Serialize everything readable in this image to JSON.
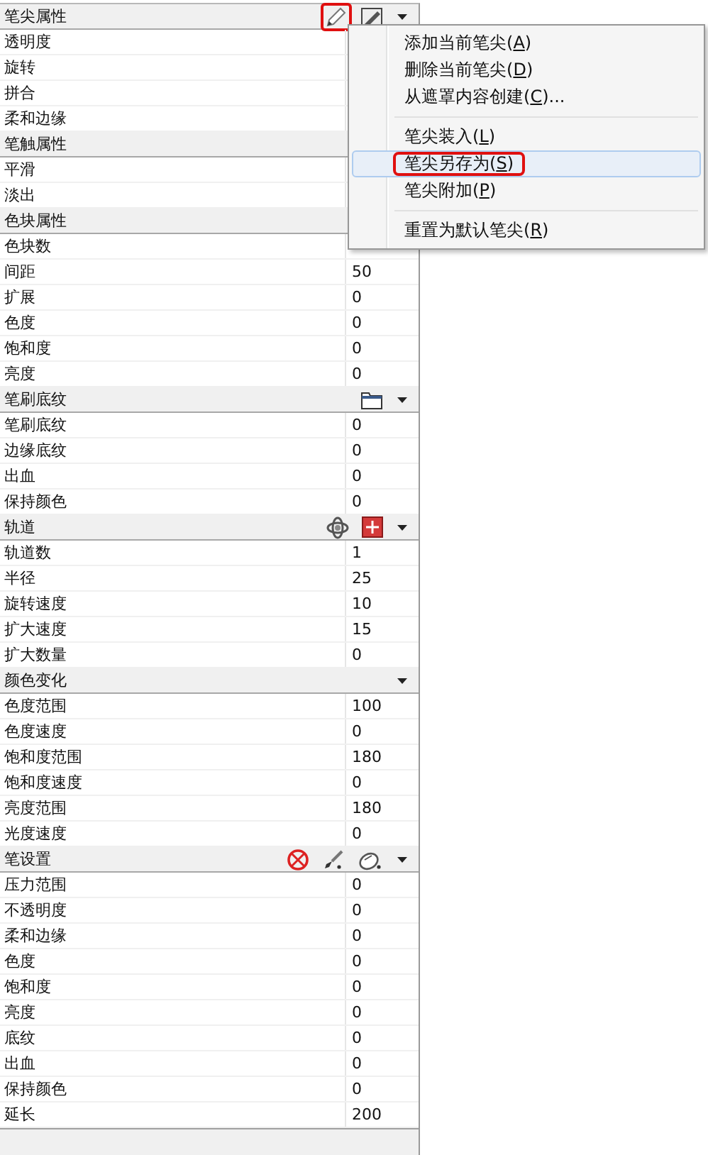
{
  "sections": [
    {
      "title": "笔尖属性",
      "tools": [
        {
          "kind": "pen",
          "highlighted": true
        },
        {
          "kind": "eraser",
          "highlighted": false
        },
        {
          "kind": "caret",
          "highlighted": false
        }
      ],
      "rows": [
        {
          "label": "透明度"
        },
        {
          "label": "旋转"
        },
        {
          "label": "拼合"
        },
        {
          "label": "柔和边缘"
        }
      ]
    },
    {
      "title": "笔触属性",
      "rows": [
        {
          "label": "平滑"
        },
        {
          "label": "淡出"
        }
      ]
    },
    {
      "title": "色块属性",
      "rows": [
        {
          "label": "色块数"
        },
        {
          "label": "间距",
          "value": "50"
        },
        {
          "label": "扩展",
          "value": "0"
        },
        {
          "label": "色度",
          "value": "0"
        },
        {
          "label": "饱和度",
          "value": "0"
        },
        {
          "label": "亮度",
          "value": "0"
        }
      ]
    },
    {
      "title": "笔刷底纹",
      "tools": [
        {
          "kind": "folder",
          "highlighted": false
        },
        {
          "kind": "caret",
          "highlighted": false
        }
      ],
      "rows": [
        {
          "label": "笔刷底纹",
          "value": "0"
        },
        {
          "label": "边缘底纹",
          "value": "0"
        },
        {
          "label": "出血",
          "value": "0"
        },
        {
          "label": "保持颜色",
          "value": "0"
        }
      ]
    },
    {
      "title": "轨道",
      "tools": [
        {
          "kind": "orbit",
          "highlighted": false
        },
        {
          "kind": "target",
          "highlighted": false
        },
        {
          "kind": "caret",
          "highlighted": false
        }
      ],
      "rows": [
        {
          "label": "轨道数",
          "value": "1"
        },
        {
          "label": "半径",
          "value": "25"
        },
        {
          "label": "旋转速度",
          "value": "10"
        },
        {
          "label": "扩大速度",
          "value": "15"
        },
        {
          "label": "扩大数量",
          "value": "0"
        }
      ]
    },
    {
      "title": "颜色变化",
      "tools": [
        {
          "kind": "caret",
          "highlighted": false
        }
      ],
      "rows": [
        {
          "label": "色度范围",
          "value": "100"
        },
        {
          "label": "色度速度",
          "value": "0"
        },
        {
          "label": "饱和度范围",
          "value": "180"
        },
        {
          "label": "饱和度速度",
          "value": "0"
        },
        {
          "label": "亮度范围",
          "value": "180"
        },
        {
          "label": "光度速度",
          "value": "0"
        }
      ]
    },
    {
      "title": "笔设置",
      "tools": [
        {
          "kind": "no-sign",
          "highlighted": false
        },
        {
          "kind": "brush",
          "highlighted": false
        },
        {
          "kind": "mouse",
          "highlighted": false
        },
        {
          "kind": "caret",
          "highlighted": false
        }
      ],
      "rows": [
        {
          "label": "压力范围",
          "value": "0"
        },
        {
          "label": "不透明度",
          "value": "0"
        },
        {
          "label": "柔和边缘",
          "value": "0"
        },
        {
          "label": "色度",
          "value": "0"
        },
        {
          "label": "饱和度",
          "value": "0"
        },
        {
          "label": "亮度",
          "value": "0"
        },
        {
          "label": "底纹",
          "value": "0"
        },
        {
          "label": "出血",
          "value": "0"
        },
        {
          "label": "保持颜色",
          "value": "0"
        },
        {
          "label": "延长",
          "value": "200"
        }
      ]
    }
  ],
  "menu": [
    {
      "kind": "item",
      "before": "添加当前笔尖(",
      "mnemonic": "A",
      "after": ")",
      "selected": false,
      "highlighted": false
    },
    {
      "kind": "item",
      "before": "删除当前笔尖(",
      "mnemonic": "D",
      "after": ")",
      "selected": false,
      "highlighted": false
    },
    {
      "kind": "item",
      "before": "从遮罩内容创建(",
      "mnemonic": "C",
      "after": ")...",
      "selected": false,
      "highlighted": false
    },
    {
      "kind": "separator"
    },
    {
      "kind": "item",
      "before": "笔尖装入(",
      "mnemonic": "L",
      "after": ")",
      "selected": false,
      "highlighted": false
    },
    {
      "kind": "item",
      "before": "笔尖另存为(",
      "mnemonic": "S",
      "after": ")",
      "selected": true,
      "highlighted": true
    },
    {
      "kind": "item",
      "before": "笔尖附加(",
      "mnemonic": "P",
      "after": ")",
      "selected": false,
      "highlighted": false
    },
    {
      "kind": "separator"
    },
    {
      "kind": "item",
      "before": "重置为默认笔尖(",
      "mnemonic": "R",
      "after": ")",
      "selected": false,
      "highlighted": false
    }
  ]
}
